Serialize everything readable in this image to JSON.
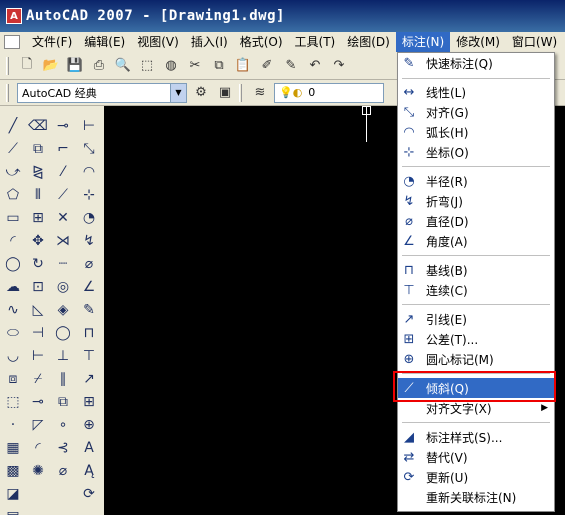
{
  "window": {
    "title": "AutoCAD 2007 - [Drawing1.dwg]",
    "app_icon": "A"
  },
  "menubar": {
    "items": [
      {
        "label": "文件(F)"
      },
      {
        "label": "编辑(E)"
      },
      {
        "label": "视图(V)"
      },
      {
        "label": "插入(I)"
      },
      {
        "label": "格式(O)"
      },
      {
        "label": "工具(T)"
      },
      {
        "label": "绘图(D)"
      },
      {
        "label": "标注(N)"
      },
      {
        "label": "修改(M)"
      },
      {
        "label": "窗口(W)"
      }
    ]
  },
  "toolbar2": {
    "workspace": "AutoCAD 经典",
    "layer": "0"
  },
  "dimension_menu": {
    "items": [
      {
        "label": "快速标注(Q)",
        "icon": "quick-dimension-icon",
        "glyph": "✎"
      },
      {
        "label": "线性(L)",
        "icon": "linear-icon",
        "glyph": "↔"
      },
      {
        "label": "对齐(G)",
        "icon": "aligned-icon",
        "glyph": "⤡"
      },
      {
        "label": "弧长(H)",
        "icon": "arc-length-icon",
        "glyph": "◠"
      },
      {
        "label": "坐标(O)",
        "icon": "ordinate-icon",
        "glyph": "⊹"
      },
      {
        "label": "半径(R)",
        "icon": "radius-icon",
        "glyph": "◔"
      },
      {
        "label": "折弯(J)",
        "icon": "jogged-icon",
        "glyph": "↯"
      },
      {
        "label": "直径(D)",
        "icon": "diameter-icon",
        "glyph": "⌀"
      },
      {
        "label": "角度(A)",
        "icon": "angular-icon",
        "glyph": "∠"
      },
      {
        "label": "基线(B)",
        "icon": "baseline-icon",
        "glyph": "⊓"
      },
      {
        "label": "连续(C)",
        "icon": "continue-icon",
        "glyph": "⊤"
      },
      {
        "label": "引线(E)",
        "icon": "leader-icon",
        "glyph": "↗"
      },
      {
        "label": "公差(T)...",
        "icon": "tolerance-icon",
        "glyph": "⊞"
      },
      {
        "label": "圆心标记(M)",
        "icon": "center-mark-icon",
        "glyph": "⊕"
      },
      {
        "label": "倾斜(Q)",
        "icon": "oblique-icon",
        "glyph": "⟋"
      },
      {
        "label": "对齐文字(X)",
        "icon": "",
        "glyph": ""
      },
      {
        "label": "标注样式(S)...",
        "icon": "dimension-style-icon",
        "glyph": "◢"
      },
      {
        "label": "替代(V)",
        "icon": "override-icon",
        "glyph": "⇄"
      },
      {
        "label": "更新(U)",
        "icon": "update-icon",
        "glyph": "⟳"
      },
      {
        "label": "重新关联标注(N)",
        "icon": "",
        "glyph": ""
      }
    ]
  }
}
